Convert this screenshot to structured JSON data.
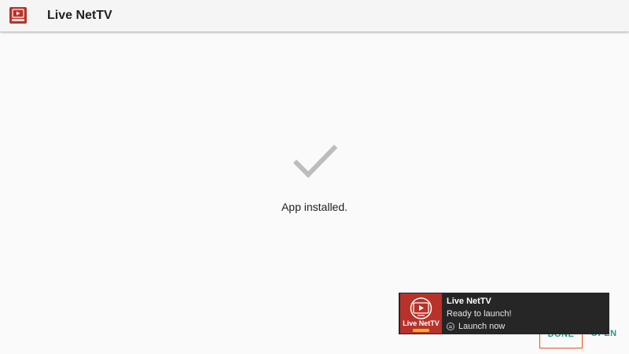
{
  "appbar": {
    "title": "Live NetTV",
    "icon": "live-nettv-app-icon"
  },
  "main": {
    "status_icon": "checkmark-icon",
    "status_text": "App installed."
  },
  "actions": {
    "done_label": "DONE",
    "open_label": "OPEN"
  },
  "notification": {
    "icon": "live-nettv-logo-icon",
    "logo_text": "Live NetTV",
    "title": "Live NetTV",
    "message": "Ready to launch!",
    "action_icon": "menu-circle-icon",
    "action_label": "Launch now"
  },
  "colors": {
    "accent": "#1e9a8c",
    "brand_red": "#c0392b",
    "toast_bg": "#262626",
    "focus_outline": "#e8521f"
  }
}
